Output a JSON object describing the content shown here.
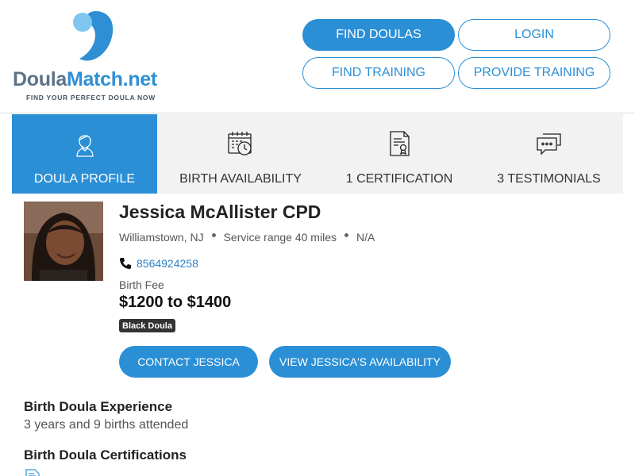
{
  "brand": {
    "name_part1": "Doula",
    "name_part2": "Match.net",
    "tagline": "FIND YOUR PERFECT DOULA NOW"
  },
  "nav": {
    "find_doulas": "FIND DOULAS",
    "login": "LOGIN",
    "find_training": "FIND TRAINING",
    "provide_training": "PROVIDE TRAINING"
  },
  "tabs": [
    {
      "label": "DOULA PROFILE",
      "icon": "person-icon",
      "active": true
    },
    {
      "label": "BIRTH AVAILABILITY",
      "icon": "calendar-clock-icon",
      "active": false
    },
    {
      "label": "1 CERTIFICATION",
      "icon": "certificate-icon",
      "active": false
    },
    {
      "label": "3 TESTIMONIALS",
      "icon": "chat-bubbles-icon",
      "active": false
    }
  ],
  "profile": {
    "name": "Jessica McAllister CPD",
    "location": "Williamstown, NJ",
    "service_range": "Service range 40 miles",
    "extra": "N/A",
    "phone": "8564924258",
    "fee_label": "Birth Fee",
    "fee_value": "$1200 to $1400",
    "badge": "Black Doula"
  },
  "actions": {
    "contact": "CONTACT JESSICA",
    "availability": "VIEW JESSICA'S AVAILABILITY"
  },
  "sections": {
    "experience_title": "Birth Doula Experience",
    "experience_text": "3 years and 9 births attended",
    "certifications_title": "Birth Doula Certifications"
  },
  "colors": {
    "accent": "#2b8fd6",
    "tab_bg": "#f2f2f2",
    "badge_bg": "#333333"
  }
}
